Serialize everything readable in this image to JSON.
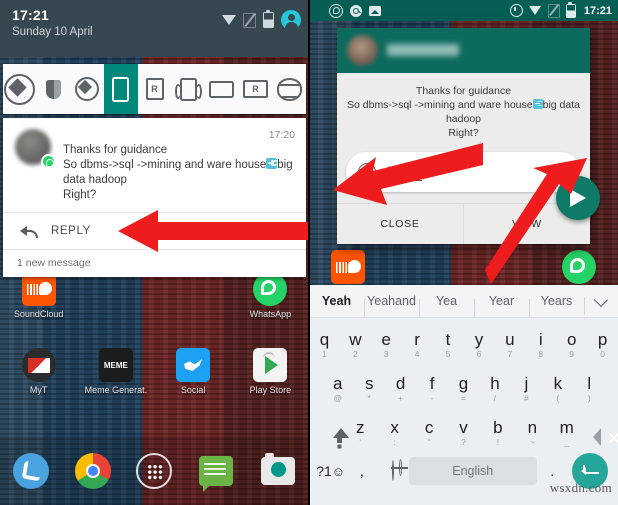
{
  "left_panel": {
    "status_bar": {
      "time": "17:21",
      "date": "Sunday 10 April",
      "icons": [
        "wifi-icon",
        "no-signal-icon",
        "battery-icon",
        "user-avatar-icon"
      ]
    },
    "rotation_toolbar": {
      "items": [
        {
          "name": "rotation-lock-icon",
          "active": false
        },
        {
          "name": "shield-icon",
          "active": false
        },
        {
          "name": "auto-rotate-icon",
          "active": false
        },
        {
          "name": "portrait-phone-icon",
          "active": true
        },
        {
          "name": "portrait-reverse-icon",
          "active": false
        },
        {
          "name": "phone-vibrate-icon",
          "active": false
        },
        {
          "name": "landscape-icon",
          "active": false
        },
        {
          "name": "landscape-reverse-icon",
          "active": false
        },
        {
          "name": "auto-orientation-icon",
          "active": false
        }
      ]
    },
    "notification": {
      "sender": "",
      "time": "17:20",
      "line1": "Thanks for guidance",
      "line2_a": "So dbms->sql ->mining and ware house",
      "line2_b": "big data hadoop",
      "line3": "Right?",
      "reply_label": "REPLY",
      "count": "1 new message"
    },
    "homescreen": {
      "row1": [
        {
          "label": "SoundCloud",
          "icon": "soundcloud-icon"
        },
        {
          "label": "",
          "icon": "blank-icon"
        },
        {
          "label": "",
          "icon": "blank-icon"
        },
        {
          "label": "WhatsApp",
          "icon": "whatsapp-icon"
        }
      ],
      "row2": [
        {
          "label": "MyT",
          "icon": "gmail-icon"
        },
        {
          "label": "Meme Generat.",
          "icon": "meme-generator-icon"
        },
        {
          "label": "Social",
          "icon": "twitter-icon"
        },
        {
          "label": "Play Store",
          "icon": "play-store-icon"
        }
      ],
      "meme_icon_text": "MEME",
      "dock": [
        {
          "name": "phone-icon"
        },
        {
          "name": "chrome-icon"
        },
        {
          "name": "all-apps-icon"
        },
        {
          "name": "messaging-icon"
        },
        {
          "name": "camera-icon"
        }
      ]
    }
  },
  "right_panel": {
    "status_bar": {
      "time": "17:21",
      "left_icons": [
        "phone-icon",
        "whatsapp-icon",
        "search-icon",
        "image-icon"
      ],
      "right_icons": [
        "alarm-icon",
        "wifi-icon",
        "no-signal-icon",
        "battery-icon"
      ]
    },
    "dialog": {
      "header_name": "",
      "message_line1": "Thanks for guidance",
      "message_line2_a": "So dbms->sql ->mining and ware house",
      "message_line2_b": "big data hadoop",
      "message_line3": "Right?",
      "input_value": "Yeah",
      "close_label": "CLOSE",
      "view_label": "VIEW",
      "send_icon": "send-icon"
    },
    "keyboard": {
      "suggestions": [
        "Yeah",
        "Yeahand",
        "Yea",
        "Year",
        "Years"
      ],
      "row1": [
        {
          "k": "q",
          "s": "1"
        },
        {
          "k": "w",
          "s": "2"
        },
        {
          "k": "e",
          "s": "3"
        },
        {
          "k": "r",
          "s": "4"
        },
        {
          "k": "t",
          "s": "5"
        },
        {
          "k": "y",
          "s": "6"
        },
        {
          "k": "u",
          "s": "7"
        },
        {
          "k": "i",
          "s": "8"
        },
        {
          "k": "o",
          "s": "9"
        },
        {
          "k": "p",
          "s": "0"
        }
      ],
      "row2": [
        {
          "k": "a",
          "s": "@"
        },
        {
          "k": "s",
          "s": "*"
        },
        {
          "k": "d",
          "s": "+"
        },
        {
          "k": "f",
          "s": "-"
        },
        {
          "k": "g",
          "s": "="
        },
        {
          "k": "h",
          "s": "/"
        },
        {
          "k": "j",
          "s": "#"
        },
        {
          "k": "k",
          "s": "("
        },
        {
          "k": "l",
          "s": ")"
        }
      ],
      "row3": [
        {
          "k": "z",
          "s": "'"
        },
        {
          "k": "x",
          "s": ":"
        },
        {
          "k": "c",
          "s": "\""
        },
        {
          "k": "v",
          "s": "?"
        },
        {
          "k": "b",
          "s": "!"
        },
        {
          "k": "n",
          "s": "~"
        },
        {
          "k": "m",
          "s": "_"
        }
      ],
      "symbols_label": "?1",
      "comma_label": ",",
      "space_label": "English",
      "period_label": ".",
      "shift_icon": "shift-icon",
      "backspace_icon": "backspace-icon",
      "globe_icon": "globe-icon",
      "enter_icon": "enter-icon"
    }
  },
  "watermark": "wsxdn.com",
  "colors": {
    "teal_accent": "#00897b",
    "whatsapp_green": "#25d366",
    "status_dark": "#37474f",
    "arrow_red": "#ee1c1c"
  }
}
